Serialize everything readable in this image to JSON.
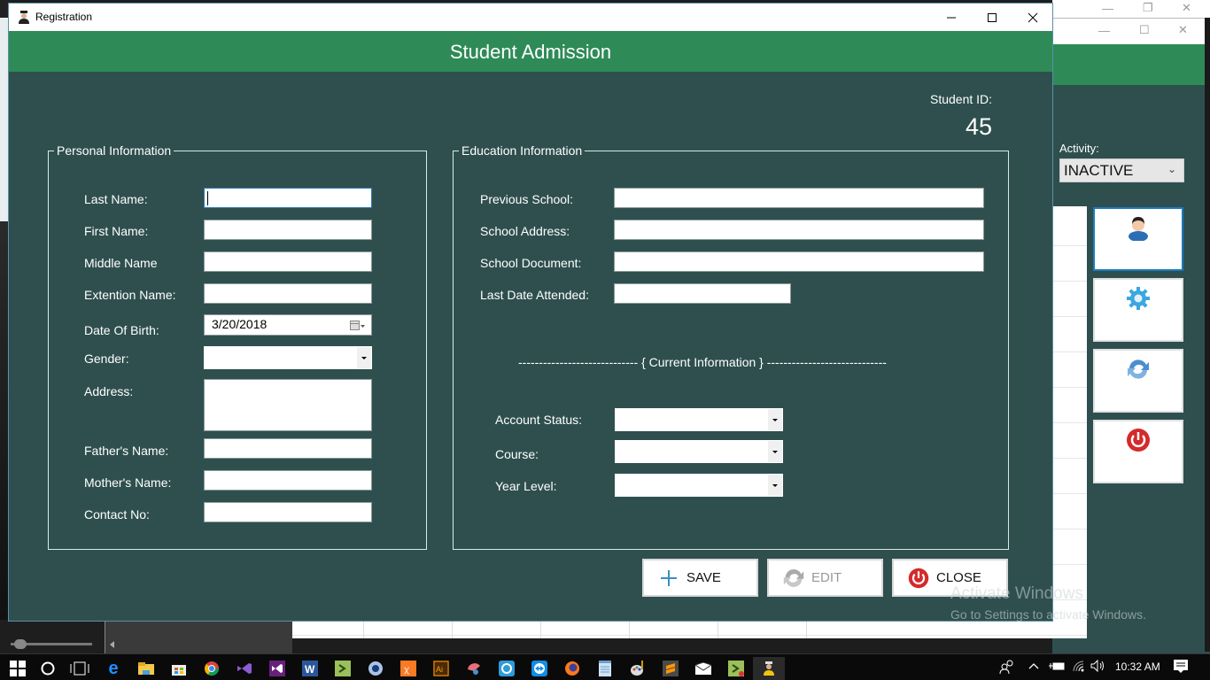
{
  "window": {
    "title": "Registration",
    "header_title": "Student Admission",
    "controls": {
      "minimize": "minimize",
      "maximize": "maximize",
      "close": "close"
    }
  },
  "student_id": {
    "label": "Student ID:",
    "value": "45"
  },
  "personal": {
    "legend": "Personal Information",
    "fields": {
      "last_name": {
        "label": "Last Name:",
        "value": ""
      },
      "first_name": {
        "label": "First Name:",
        "value": ""
      },
      "middle_name": {
        "label": "Middle Name",
        "value": ""
      },
      "extension_name": {
        "label": "Extention Name:",
        "value": ""
      },
      "dob": {
        "label": "Date Of Birth:",
        "value": "3/20/2018"
      },
      "gender": {
        "label": "Gender:",
        "value": ""
      },
      "address": {
        "label": "Address:",
        "value": ""
      },
      "father": {
        "label": "Father's Name:",
        "value": ""
      },
      "mother": {
        "label": "Mother's Name:",
        "value": ""
      },
      "contact": {
        "label": "Contact No:",
        "value": ""
      }
    }
  },
  "education": {
    "legend": "Education Information",
    "fields": {
      "previous_school": {
        "label": "Previous School:",
        "value": ""
      },
      "school_address": {
        "label": "School Address:",
        "value": ""
      },
      "school_document": {
        "label": "School Document:",
        "value": ""
      },
      "last_date_attended": {
        "label": "Last Date Attended:",
        "value": ""
      }
    },
    "separator": "----------------------------- { Current Information } -----------------------------",
    "current": {
      "account_status": {
        "label": "Account Status:",
        "value": ""
      },
      "course": {
        "label": "Course:",
        "value": ""
      },
      "year_level": {
        "label": "Year Level:",
        "value": ""
      }
    }
  },
  "actions": {
    "save": "SAVE",
    "edit": "EDIT",
    "close": "CLOSE"
  },
  "background_window": {
    "activity_label": "Activity:",
    "activity_value": "INACTIVE",
    "side_buttons": [
      "STUDENTS",
      "SETTINGS",
      "REFRESH",
      "EXIT"
    ]
  },
  "watermark": {
    "line1": "Activate Windows",
    "line2": "Go to Settings to activate Windows."
  },
  "taskbar": {
    "time": "10:32 AM",
    "apps": [
      "start",
      "cortana",
      "task-view",
      "edge",
      "file-explorer",
      "store",
      "chrome",
      "visual-studio",
      "visual-studio-2",
      "word",
      "console-app",
      "app-config",
      "xampp",
      "illustrator",
      "paint-app",
      "teamviewer-alt",
      "teamviewer",
      "firefox",
      "notepad",
      "paint",
      "sublime-text",
      "mail",
      "console-app-2",
      "registration-app"
    ]
  },
  "colors": {
    "header_green": "#2e8b57",
    "body_dark": "#2f4f4f",
    "focus_blue": "#2a7bb8"
  }
}
